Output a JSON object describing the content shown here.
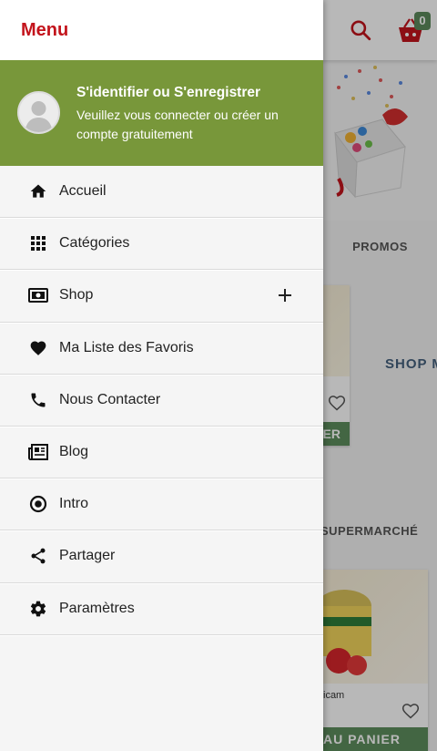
{
  "app_bar": {
    "cart_count": "0"
  },
  "background": {
    "tab_promos": "PROMOS",
    "shop_more": "SHOP M",
    "card1_button": "ER",
    "section_supermarche": "SUPERMARCHÉ",
    "card2_label": "icam",
    "card2_button": "AU PANIER"
  },
  "drawer": {
    "title": "Menu",
    "account": {
      "headline": "S'identifier ou S'enregistrer",
      "subtext": "Veuillez vous connecter ou créer un compte gratuitement"
    },
    "items": [
      {
        "label": "Accueil",
        "icon": "home-icon"
      },
      {
        "label": "Catégories",
        "icon": "grid-icon"
      },
      {
        "label": "Shop",
        "icon": "money-icon",
        "expandable": true
      },
      {
        "label": "Ma Liste des Favoris",
        "icon": "heart-icon"
      },
      {
        "label": "Nous Contacter",
        "icon": "phone-icon"
      },
      {
        "label": "Blog",
        "icon": "newspaper-icon"
      },
      {
        "label": "Intro",
        "icon": "intro-icon"
      },
      {
        "label": "Partager",
        "icon": "share-icon"
      },
      {
        "label": "Paramètres",
        "icon": "gear-icon"
      }
    ]
  },
  "colors": {
    "brand_red": "#c3141c",
    "account_green": "#78973a",
    "button_green": "#5d8e5d"
  }
}
